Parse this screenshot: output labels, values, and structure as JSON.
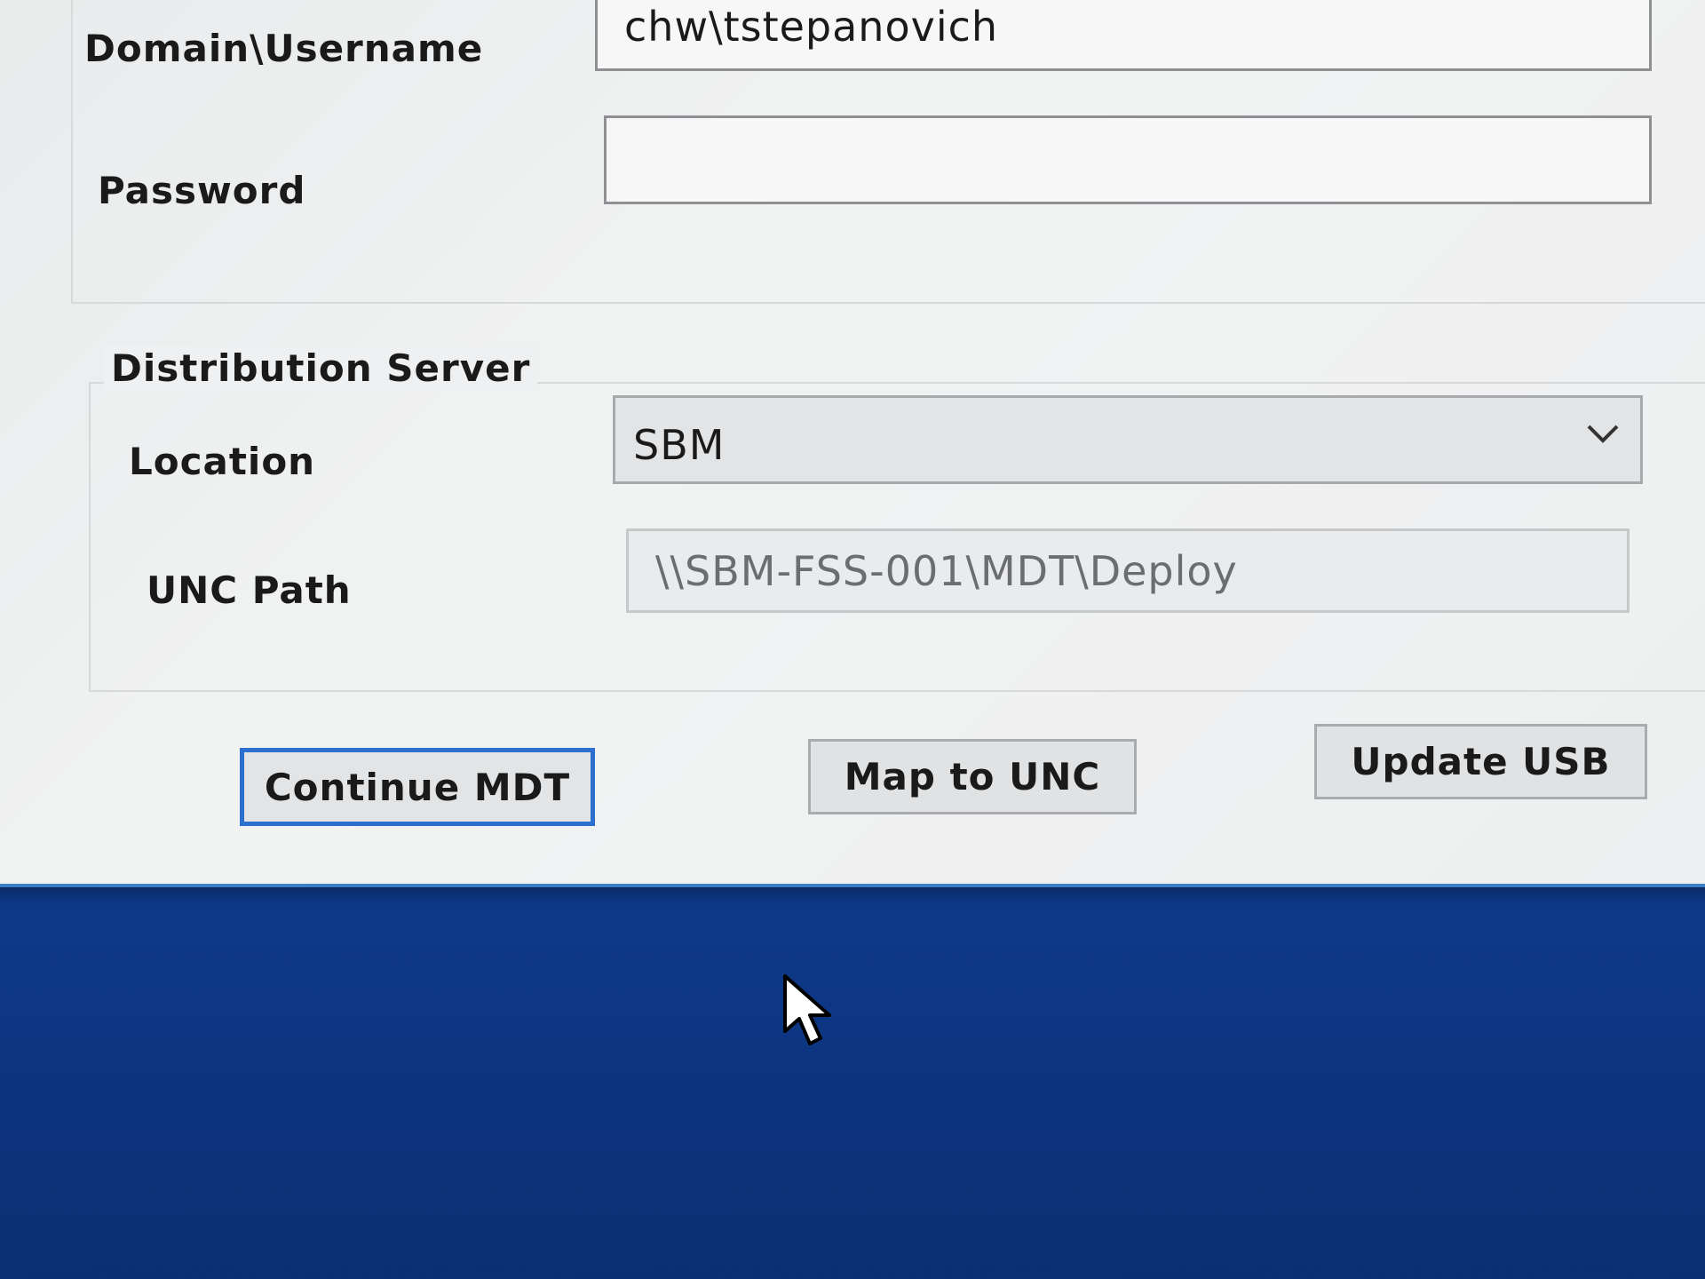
{
  "credentials": {
    "username_label": "Domain\\Username",
    "username_value": "chw\\tstepanovich",
    "password_label": "Password",
    "password_value": ""
  },
  "distribution_server": {
    "title": "Distribution Server",
    "location_label": "Location",
    "location_value": "SBM",
    "unc_label": "UNC Path",
    "unc_value": "\\\\SBM-FSS-001\\MDT\\Deploy"
  },
  "buttons": {
    "continue": "Continue MDT",
    "map": "Map to UNC",
    "update": "Update USB"
  },
  "icons": {
    "dropdown": "chevron-down-icon",
    "pointer": "mouse-pointer-icon"
  },
  "colors": {
    "desktop": "#1548a0",
    "dialog": "#eeeff0",
    "focus_border": "#2b6fcf"
  }
}
